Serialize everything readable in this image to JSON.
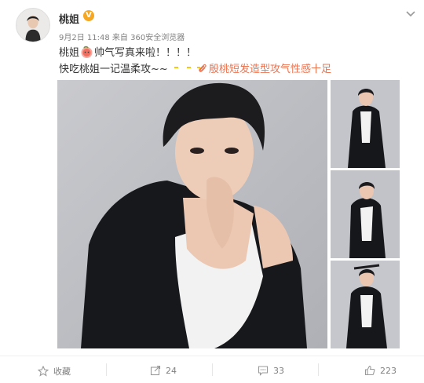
{
  "post": {
    "username": "桃姐",
    "vip_badge": "V",
    "date": "9月2日 11:48",
    "from_label": "来自",
    "source": "360安全浏览器",
    "line1_before": "桃姐",
    "line1_after": "帅气写真来啦！！！！",
    "line2": "快吃桃姐一记温柔攻~~",
    "link_text": "殷桃短发造型攻气性感十足",
    "link_icon": "paperclip-icon",
    "emoji_icon": "peach-face-emoji-icon"
  },
  "actions": {
    "favorite_label": "收藏",
    "repost_count": "24",
    "comment_count": "33",
    "like_count": "223"
  },
  "colors": {
    "link": "#eb7350",
    "badge": "#f5a623",
    "meta": "#808080",
    "text": "#333333"
  }
}
